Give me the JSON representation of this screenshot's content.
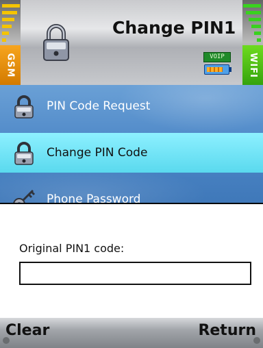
{
  "header": {
    "title": "Change PIN1",
    "voip_badge": "VOIP",
    "left_network": "GSM",
    "right_network": "WIFI",
    "battery_level": 0.8
  },
  "menu": {
    "items": [
      {
        "label": "PIN Code Request",
        "icon": "lock-icon",
        "selected": false
      },
      {
        "label": "Change PIN Code",
        "icon": "lock-icon",
        "selected": true
      },
      {
        "label": "Phone Password",
        "icon": "key-icon",
        "selected": false
      }
    ]
  },
  "dialog": {
    "prompt": "Original PIN1 code:",
    "value": ""
  },
  "softkeys": {
    "left": "Clear",
    "right": "Return"
  },
  "colors": {
    "menu_background": "#4c86c6",
    "selected_item": "#5ad9ee",
    "gsm_tag": "#f7a51e",
    "wifi_tag": "#6edb1f"
  }
}
